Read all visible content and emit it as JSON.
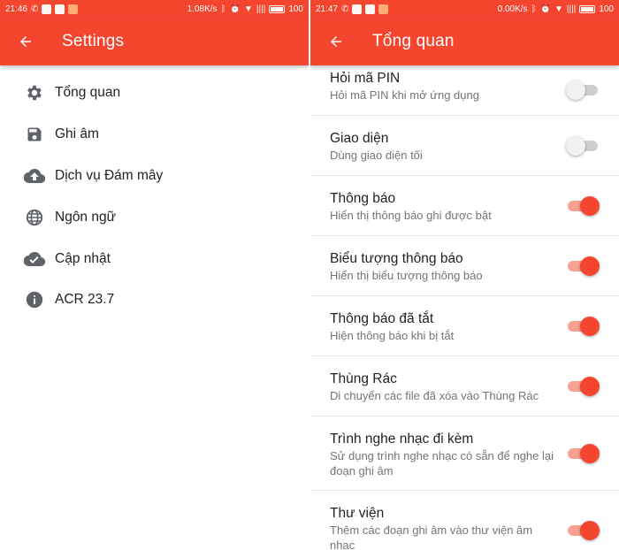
{
  "left": {
    "status": {
      "time": "21:46",
      "speed": "1.08K/s",
      "battery": "100"
    },
    "appbar": {
      "title": "Settings"
    },
    "menu": [
      {
        "label": "Tổng quan",
        "icon": "gear-icon"
      },
      {
        "label": "Ghi âm",
        "icon": "save-icon"
      },
      {
        "label": "Dịch vụ Đám mây",
        "icon": "cloud-upload-icon"
      },
      {
        "label": "Ngôn ngữ",
        "icon": "globe-icon"
      },
      {
        "label": "Cập nhật",
        "icon": "cloud-check-icon"
      },
      {
        "label": "ACR 23.7",
        "icon": "info-icon"
      }
    ]
  },
  "right": {
    "status": {
      "time": "21:47",
      "speed": "0.00K/s",
      "battery": "100"
    },
    "appbar": {
      "title": "Tổng quan"
    },
    "settings": [
      {
        "title": "Hỏi mã PIN",
        "subtitle": "Hỏi mã PIN khi mở ứng dụng",
        "enabled": false
      },
      {
        "title": "Giao diện",
        "subtitle": "Dùng giao diện tối",
        "enabled": false
      },
      {
        "title": "Thông báo",
        "subtitle": "Hiển thị thông báo ghi được bật",
        "enabled": true
      },
      {
        "title": "Biểu tượng thông báo",
        "subtitle": "Hiển thị biểu tượng thông báo",
        "enabled": true
      },
      {
        "title": "Thông báo đã tắt",
        "subtitle": "Hiện thông báo khi bị tắt",
        "enabled": true
      },
      {
        "title": "Thùng Rác",
        "subtitle": "Di chuyển các file đã xóa vào Thùng Rác",
        "enabled": true
      },
      {
        "title": "Trình nghe nhạc đi kèm",
        "subtitle": "Sử dụng trình nghe nhạc có sẵn để nghe lại đoạn ghi âm",
        "enabled": true
      },
      {
        "title": "Thư viện",
        "subtitle": "Thêm các đoạn ghi âm vào thư viện âm nhạc",
        "enabled": true
      }
    ]
  },
  "colors": {
    "accent": "#f4452f",
    "accent_light": "#f9a190",
    "text": "#222222",
    "subtext": "#757575"
  }
}
